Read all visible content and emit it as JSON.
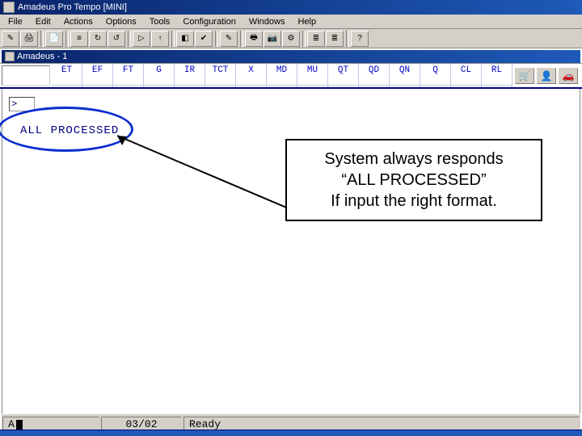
{
  "titlebar": {
    "text": "Amadeus Pro Tempo [MINI]"
  },
  "menu": {
    "file": "File",
    "edit": "Edit",
    "actions": "Actions",
    "options": "Options",
    "tools": "Tools",
    "configuration": "Configuration",
    "windows": "Windows",
    "help": "Help"
  },
  "toolbar_icons": {
    "i0": "✎",
    "i1": "🖨",
    "i2": "📄",
    "i3": "≡",
    "i4": "↻",
    "i5": "↺",
    "i6": "▷",
    "i7": "↑",
    "i8": "◧",
    "i9": "✔",
    "i10": "✎",
    "i11": "🖶",
    "i12": "📷",
    "i13": "⚙",
    "i14": "≣",
    "i15": "≣",
    "i16": "?"
  },
  "child_window": {
    "title": "Amadeus - 1"
  },
  "tabs": [
    "ET",
    "EF",
    "FT",
    "G",
    "IR",
    "TCT",
    "X",
    "MD",
    "MU",
    "QT",
    "QD",
    "QN",
    "Q",
    "CL",
    "RL"
  ],
  "right_icons": {
    "i0": "🛒",
    "i1": "👤",
    "i2": "🚗"
  },
  "terminal": {
    "input_value": ">",
    "response": "ALL  PROCESSED"
  },
  "callout": {
    "line1": "System always responds",
    "line2": "“ALL PROCESSED”",
    "line3": "If input the right format."
  },
  "status": {
    "left_prefix": "A",
    "center": "03/02",
    "right": "Ready"
  },
  "colors": {
    "accent": "#0a246a",
    "ellipse": "#0b2ecf",
    "terminal_text": "#000080"
  }
}
